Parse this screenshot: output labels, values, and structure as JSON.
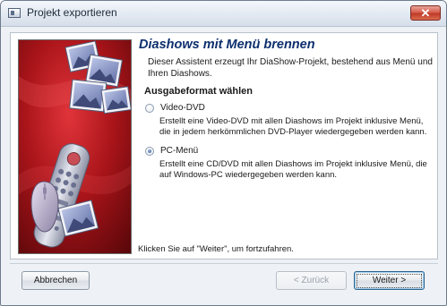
{
  "window": {
    "title": "Projekt exportieren",
    "close_label": "✕"
  },
  "main": {
    "heading": "Diashows mit Menü brennen",
    "intro": "Dieser Assistent erzeugt Ihr DiaShow-Projekt, bestehend aus Menü und Ihren Diashows.",
    "section_title": "Ausgabeformat wählen",
    "options": [
      {
        "label": "Video-DVD",
        "description": "Erstellt eine Video-DVD mit allen Diashows im Projekt inklusive Menü, die in jedem herkömmlichen DVD-Player wiedergegeben werden kann.",
        "selected": false
      },
      {
        "label": "PC-Menü",
        "description": "Erstellt eine CD/DVD mit allen Diashows im Projekt inklusive Menü, die auf Windows-PC wiedergegeben werden kann.",
        "selected": true
      }
    ],
    "footer_hint": "Klicken Sie auf \"Weiter\", um fortzufahren."
  },
  "buttons": {
    "cancel": "Abbrechen",
    "back": "< Zurück",
    "next": "Weiter >"
  },
  "colors": {
    "heading": "#0d2f6e",
    "image_background": "#7a0d10",
    "close_button": "#c03a27"
  },
  "icons": {
    "app": "window-icon",
    "close": "close-icon"
  }
}
